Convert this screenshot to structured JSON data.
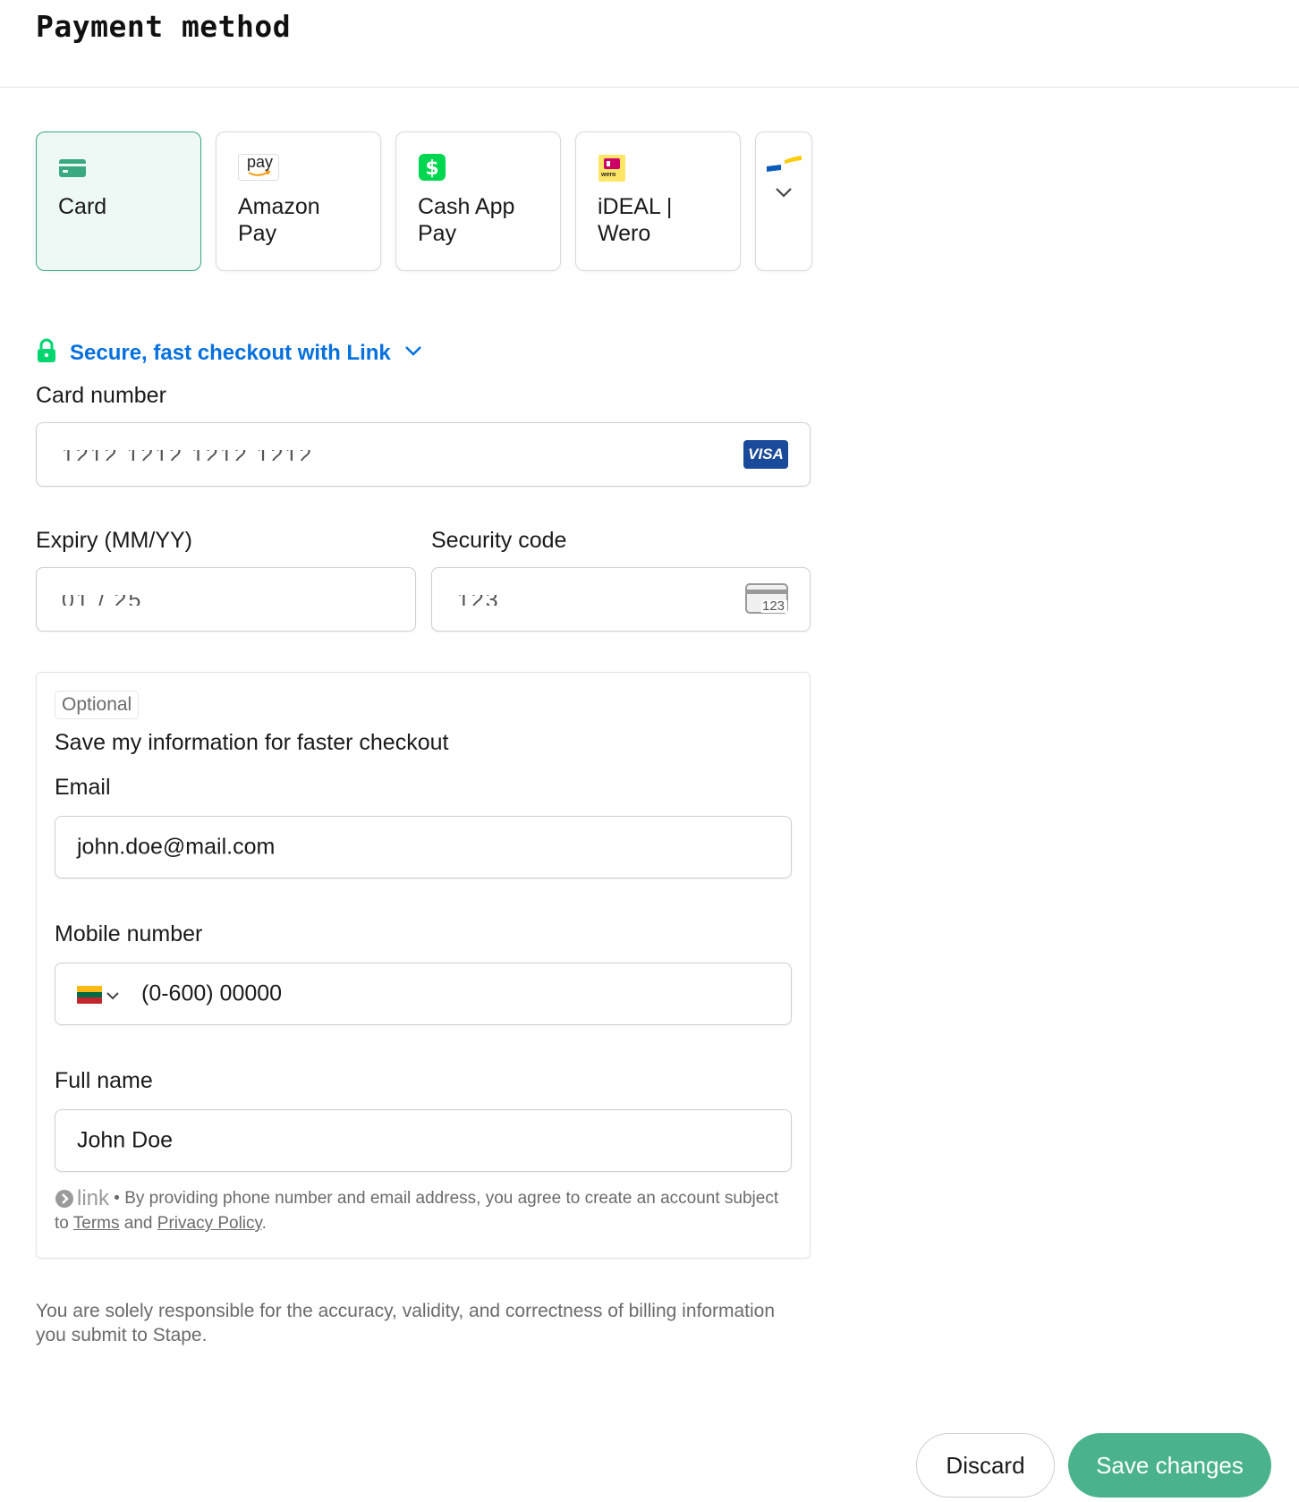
{
  "header": {
    "title": "Payment method"
  },
  "payment_methods": [
    {
      "label": "Card",
      "icon": "card-icon",
      "selected": true
    },
    {
      "label": "Amazon\nPay",
      "icon": "amazon-pay-icon",
      "icon_text": "pay",
      "selected": false
    },
    {
      "label": "Cash App\nPay",
      "icon": "cash-app-icon",
      "selected": false
    },
    {
      "label": "iDEAL |\nWero",
      "icon": "ideal-wero-icon",
      "icon_text": "wero",
      "selected": false
    }
  ],
  "link_checkout": {
    "text": "Secure, fast checkout with Link",
    "icon": "lock-icon"
  },
  "card": {
    "number_label": "Card number",
    "number_value": "1212 1212 1212 1212",
    "brand": "VISA",
    "expiry_label": "Expiry (MM/YY)",
    "expiry_value": "01 / 25",
    "security_label": "Security code",
    "security_value": "123",
    "cvc_icon_text": "123"
  },
  "save_info": {
    "optional_badge": "Optional",
    "heading": "Save my information for faster checkout",
    "email_label": "Email",
    "email_value": "john.doe@mail.com",
    "mobile_label": "Mobile number",
    "mobile_value": "(0-600) 00000",
    "name_label": "Full name",
    "name_value": "John Doe",
    "link_logo": "link",
    "terms_prefix": " • By providing phone number and email address, you agree to create an account subject to ",
    "terms_link": "Terms",
    "terms_and": " and ",
    "privacy_link": "Privacy Policy",
    "terms_suffix": "."
  },
  "disclaimer": "You are solely responsible for the accuracy, validity, and correctness of billing information you submit to Stape.",
  "actions": {
    "discard": "Discard",
    "save": "Save changes"
  },
  "colors": {
    "accent": "#4bb38c",
    "link_blue": "#0570de",
    "link_green": "#00d66f",
    "visa_blue": "#1a4a9a"
  }
}
